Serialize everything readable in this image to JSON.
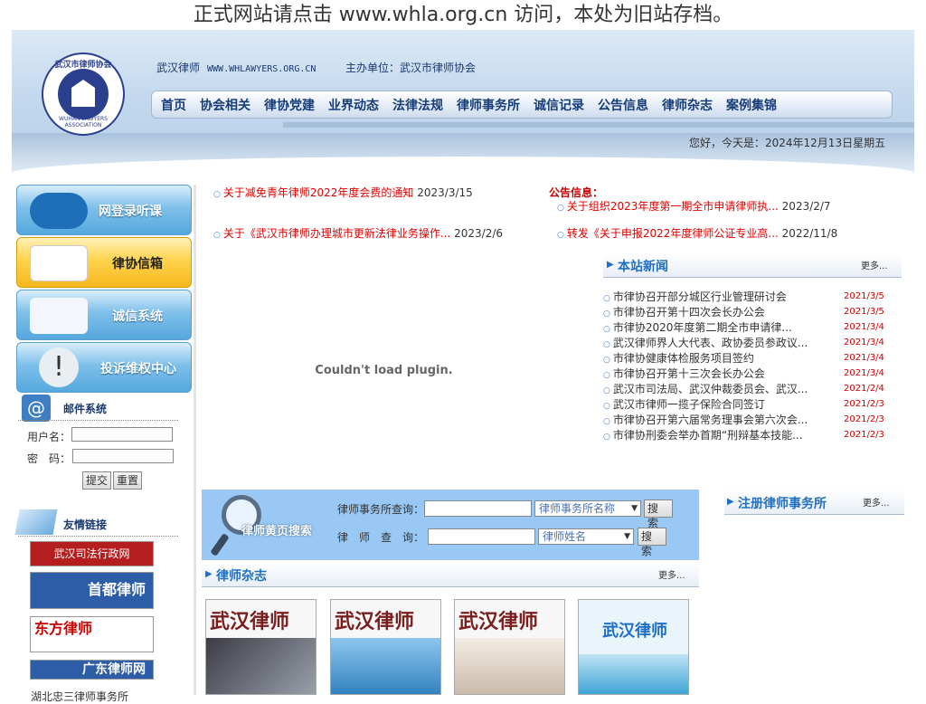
{
  "notice": "正式网站请点击 www.whla.org.cn 访问，本处为旧站存档。",
  "header": {
    "logo_text": "武汉市律师协会",
    "logo_en": "WUHAN LAWYERS ASSOCIATION",
    "site_name": "武汉律师",
    "site_url": "WWW.WHLAWYERS.ORG.CN",
    "host": "主办单位：武汉市律师协会",
    "greeting": "您好，今天是：2024年12月13日星期五"
  },
  "nav": [
    "首页",
    "协会相关",
    "律协党建",
    "业界动态",
    "法律法规",
    "律师事务所",
    "诚信记录",
    "公告信息",
    "律师杂志",
    "案例集锦"
  ],
  "sidebar": {
    "buttons": [
      "网登录听课",
      "律协信箱",
      "诚信系统",
      "投诉维权中心"
    ],
    "mail_title": "邮件系统",
    "username_label": "用户名：",
    "password_label": "密　码：",
    "submit": "提交",
    "reset": "重置",
    "links_title": "友情链接",
    "links": [
      "武汉司法行政网",
      "首都律师",
      "东方律师",
      "广东律师网"
    ],
    "bottom_text": "湖北忠三律师事务所"
  },
  "top_news_left": [
    {
      "title": "关于减免青年律师2022年度会费的通知",
      "date": "2023/3/15"
    },
    {
      "title": "关于《武汉市律师办理城市更新法律业务操作...",
      "date": "2023/2/6"
    }
  ],
  "announcements": {
    "label": "公告信息：",
    "items": [
      {
        "title": "关于组织2023年度第一期全市申请律师执...",
        "date": "2023/2/7"
      },
      {
        "title": "转发《关于申报2022年度律师公证专业高...",
        "date": "2022/11/8"
      }
    ]
  },
  "plugin_message": "Couldn't load plugin.",
  "site_news": {
    "title": "本站新闻",
    "more": "更多...",
    "items": [
      {
        "title": "市律协召开部分城区行业管理研讨会",
        "date": "2021/3/5"
      },
      {
        "title": "市律协召开第十四次会长办公会",
        "date": "2021/3/5"
      },
      {
        "title": "市律协2020年度第二期全市申请律...",
        "date": "2021/3/4"
      },
      {
        "title": "武汉律师界人大代表、政协委员参政议...",
        "date": "2021/3/4"
      },
      {
        "title": "市律协健康体检服务项目签约",
        "date": "2021/3/4"
      },
      {
        "title": "市律协召开第十三次会长办公会",
        "date": "2021/3/4"
      },
      {
        "title": "武汉市司法局、武汉仲裁委员会、武汉...",
        "date": "2021/2/4"
      },
      {
        "title": "武汉市律师一揽子保险合同签订",
        "date": "2021/2/3"
      },
      {
        "title": "市律协召开第六届常务理事会第六次会...",
        "date": "2021/2/3"
      },
      {
        "title": "市律协刑委会举办首期“刑辩基本技能...",
        "date": "2021/2/3"
      }
    ]
  },
  "search": {
    "banner": "律师黄页搜索",
    "firm_label": "律师事务所查询：",
    "firm_select": "律师事务所名称",
    "lawyer_label": "律　师　查　询：",
    "lawyer_select": "律师姓名",
    "button": "搜 索"
  },
  "magazine": {
    "title": "律师杂志",
    "more": "更多...",
    "cover_title": "武汉律师"
  },
  "registered": {
    "title": "注册律师事务所",
    "more": "更多..."
  }
}
